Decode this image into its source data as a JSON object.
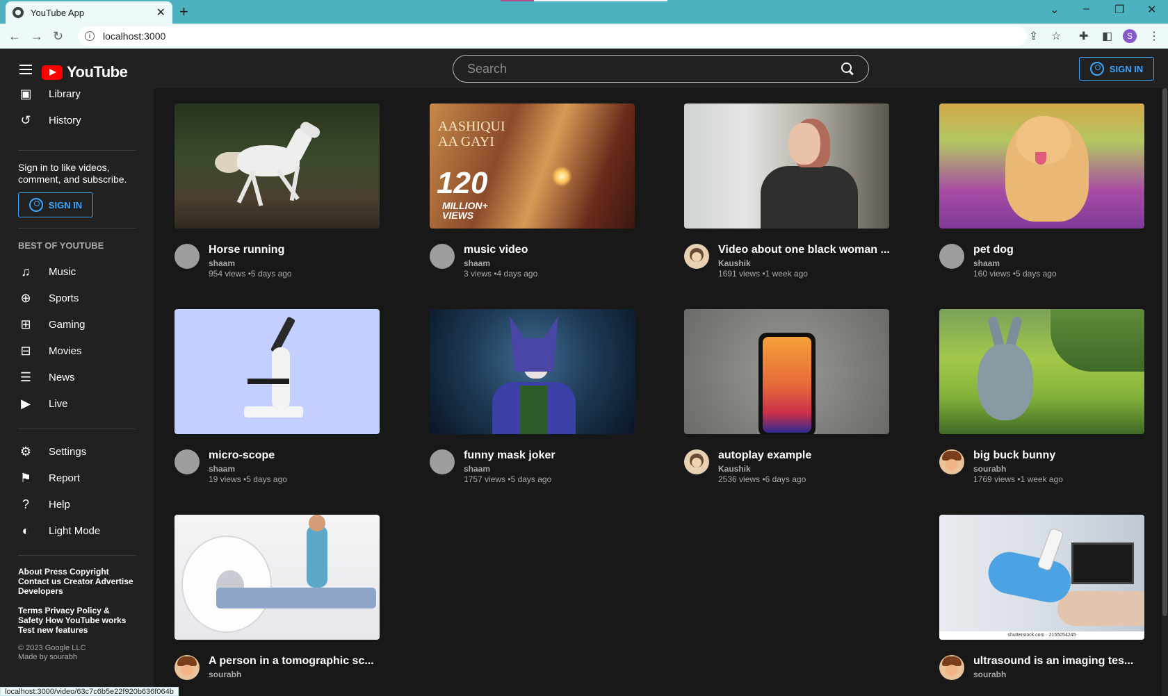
{
  "browser": {
    "tab_title": "YouTube App",
    "tab_close": "✕",
    "new_tab": "+",
    "url": "localhost:3000",
    "status_url": "localhost:3000/video/63c7c6b5e22f920b636f064b",
    "profile_initial": "S"
  },
  "header": {
    "logo_text": "YouTube",
    "search_placeholder": "Search",
    "signin_label": "SIGN IN"
  },
  "sidebar": {
    "items_top": [
      {
        "label": "Library",
        "icon": "library-icon"
      },
      {
        "label": "History",
        "icon": "history-icon"
      }
    ],
    "signin_prompt": "Sign in to like videos, comment, and subscribe.",
    "signin_label": "SIGN IN",
    "best_heading": "BEST OF YOUTUBE",
    "best_items": [
      {
        "label": "Music",
        "icon": "music-icon"
      },
      {
        "label": "Sports",
        "icon": "sports-icon"
      },
      {
        "label": "Gaming",
        "icon": "gaming-icon"
      },
      {
        "label": "Movies",
        "icon": "movies-icon"
      },
      {
        "label": "News",
        "icon": "news-icon"
      },
      {
        "label": "Live",
        "icon": "live-icon"
      }
    ],
    "settings_items": [
      {
        "label": "Settings",
        "icon": "gear-icon"
      },
      {
        "label": "Report",
        "icon": "flag-icon"
      },
      {
        "label": "Help",
        "icon": "help-icon"
      },
      {
        "label": "Light Mode",
        "icon": "light-mode-icon"
      }
    ],
    "footer_links_1": "About Press Copyright Contact us Creator Advertise Developers",
    "footer_links_2": "Terms Privacy Policy & Safety How YouTube works Test new features",
    "copyright": "© 2023 Google LLC",
    "made_by": "Made by sourabh"
  },
  "videos": [
    {
      "title": "Horse running",
      "channel": "shaam",
      "stats": "954 views •5 days ago"
    },
    {
      "title": "music video",
      "channel": "shaam",
      "stats": "3 views •4 days ago"
    },
    {
      "title": "Video about one black woman ...",
      "channel": "Kaushik",
      "stats": "1691 views •1 week ago"
    },
    {
      "title": "pet dog",
      "channel": "shaam",
      "stats": "160 views •5 days ago"
    },
    {
      "title": "micro-scope",
      "channel": "shaam",
      "stats": "19 views •5 days ago"
    },
    {
      "title": "funny mask joker",
      "channel": "shaam",
      "stats": "1757 views •5 days ago"
    },
    {
      "title": "autoplay example",
      "channel": "Kaushik",
      "stats": "2536 views •6 days ago"
    },
    {
      "title": "big buck bunny",
      "channel": "sourabh",
      "stats": "1769 views •1 week ago"
    },
    {
      "title": "A person in a tomographic sc...",
      "channel": "sourabh",
      "stats": ""
    },
    {
      "title": "ultrasound is an imaging tes...",
      "channel": "sourabh",
      "stats": ""
    }
  ],
  "thumb_text": {
    "music_title": "AASHIQUI AA GAYI",
    "music_big": "120",
    "music_sub": "MILLION+ VIEWS",
    "us_watermark": "shutterstock.com · 2155054245"
  }
}
